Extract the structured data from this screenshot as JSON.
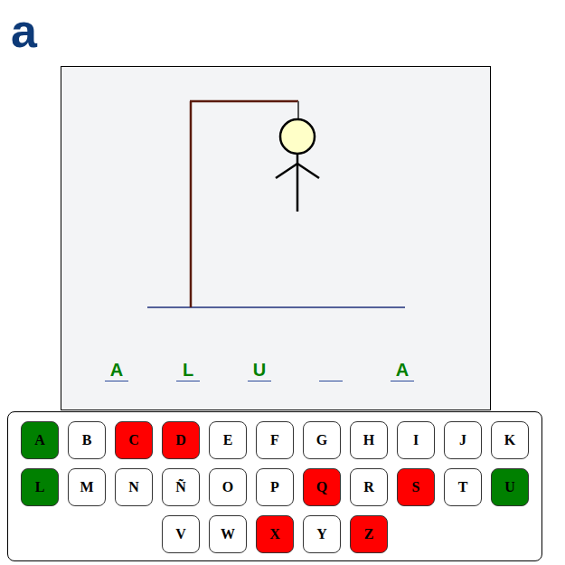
{
  "logo": "a",
  "figure": [
    {
      "kind": "rope",
      "drawn": true
    },
    {
      "kind": "head",
      "drawn": true
    },
    {
      "kind": "body",
      "drawn": true
    },
    {
      "kind": "left-arm",
      "drawn": true
    },
    {
      "kind": "right-arm",
      "drawn": true
    },
    {
      "kind": "left-leg",
      "drawn": false
    },
    {
      "kind": "right-leg",
      "drawn": false
    }
  ],
  "word": [
    {
      "letter": "A",
      "revealed": true
    },
    {
      "letter": "L",
      "revealed": true
    },
    {
      "letter": "U",
      "revealed": true
    },
    {
      "letter": "",
      "revealed": false
    },
    {
      "letter": "A",
      "revealed": true
    }
  ],
  "keyboard": [
    [
      {
        "label": "A",
        "color": "#008000"
      },
      {
        "label": "B",
        "color": "#ffffff"
      },
      {
        "label": "C",
        "color": "#ff0000"
      },
      {
        "label": "D",
        "color": "#ff0000"
      },
      {
        "label": "E",
        "color": "#ffffff"
      },
      {
        "label": "F",
        "color": "#ffffff"
      },
      {
        "label": "G",
        "color": "#ffffff"
      },
      {
        "label": "H",
        "color": "#ffffff"
      },
      {
        "label": "I",
        "color": "#ffffff"
      },
      {
        "label": "J",
        "color": "#ffffff"
      },
      {
        "label": "K",
        "color": "#ffffff"
      }
    ],
    [
      {
        "label": "L",
        "color": "#008000"
      },
      {
        "label": "M",
        "color": "#ffffff"
      },
      {
        "label": "N",
        "color": "#ffffff"
      },
      {
        "label": "Ñ",
        "color": "#ffffff"
      },
      {
        "label": "O",
        "color": "#ffffff"
      },
      {
        "label": "P",
        "color": "#ffffff"
      },
      {
        "label": "Q",
        "color": "#ff0000"
      },
      {
        "label": "R",
        "color": "#ffffff"
      },
      {
        "label": "S",
        "color": "#ff0000"
      },
      {
        "label": "T",
        "color": "#ffffff"
      },
      {
        "label": "U",
        "color": "#008000"
      }
    ],
    [
      {
        "label": "V",
        "color": "#ffffff"
      },
      {
        "label": "W",
        "color": "#ffffff"
      },
      {
        "label": "X",
        "color": "#ff0000"
      },
      {
        "label": "Y",
        "color": "#ffffff"
      },
      {
        "label": "Z",
        "color": "#ff0000"
      }
    ]
  ]
}
